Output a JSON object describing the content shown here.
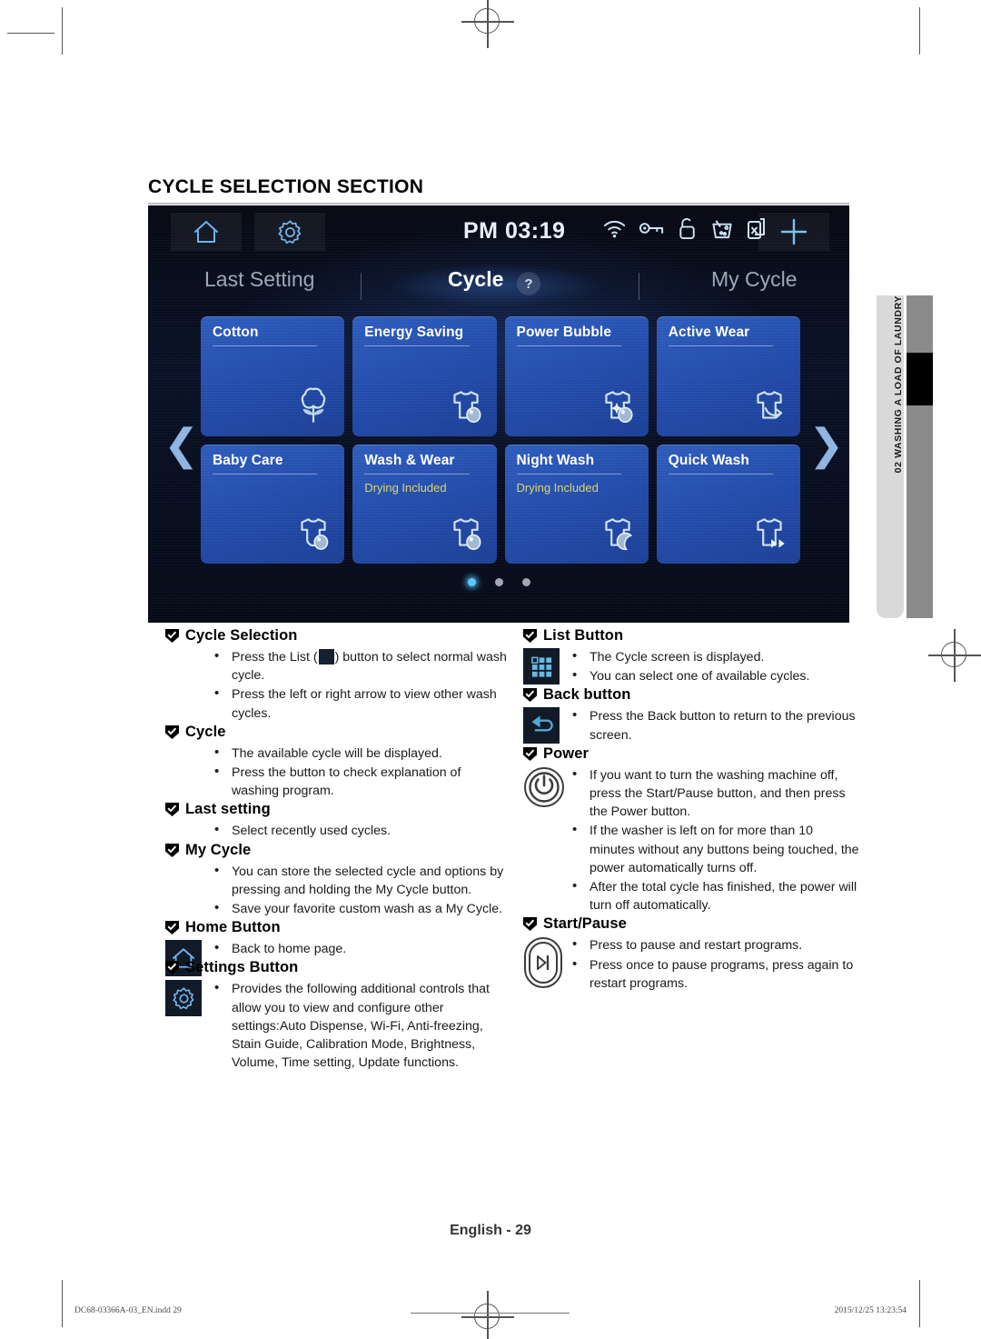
{
  "section": {
    "title": "CYCLE SELECTION SECTION"
  },
  "side_tab": {
    "label": "02 WASHING A LOAD OF LAUNDRY"
  },
  "display": {
    "status_bar": {
      "home_icon": "home-icon",
      "settings_icon": "gear-icon",
      "clock": "PM 03:19",
      "icons": [
        "wifi-icon",
        "key-icon",
        "door-unlock-icon",
        "auto-dispense-icon",
        "no-spin-icon"
      ],
      "add_icon": "plus-icon"
    },
    "tabs": [
      {
        "label": "Last Setting",
        "active": false
      },
      {
        "label": "Cycle",
        "active": true
      },
      {
        "label": "My Cycle",
        "active": false
      }
    ],
    "help_badge": "?",
    "arrow_left": "❮",
    "arrow_right": "❯",
    "cycles": [
      {
        "name": "Cotton",
        "sub": "",
        "icon": "cotton-boll-icon"
      },
      {
        "name": "Energy Saving",
        "sub": "",
        "icon": "shirt-bubble-icon"
      },
      {
        "name": "Power Bubble",
        "sub": "",
        "icon": "shirt-sparkle-bubble-icon"
      },
      {
        "name": "Active Wear",
        "sub": "",
        "icon": "shirt-arrow-icon"
      },
      {
        "name": "Baby Care",
        "sub": "",
        "icon": "onesie-bubble-icon"
      },
      {
        "name": "Wash & Wear",
        "sub": "Drying Included",
        "icon": "shirt-bubble-icon"
      },
      {
        "name": "Night Wash",
        "sub": "Drying Included",
        "icon": "shirt-moon-icon"
      },
      {
        "name": "Quick Wash",
        "sub": "",
        "icon": "shirt-fastforward-icon"
      }
    ],
    "page_dots": {
      "count": 3,
      "active_index": 0
    }
  },
  "left_column": [
    {
      "heading": "Cycle Selection",
      "icon": null,
      "bullets_html": [
        "Press the List (<span class=\"inline-list-ico\" data-name=\"list-grid-icon\" data-interactable=\"false\"></span>) button to select normal wash cycle.",
        "Press the left or right arrow to view other wash cycles."
      ]
    },
    {
      "heading": "Cycle",
      "icon": null,
      "bullets_html": [
        "The available cycle will be displayed.",
        "Press the button to check explanation of washing program."
      ]
    },
    {
      "heading": "Last setting",
      "icon": null,
      "bullets_html": [
        "Select recently used cycles."
      ]
    },
    {
      "heading": "My Cycle",
      "icon": null,
      "bullets_html": [
        "You can store the selected cycle and options by pressing and holding the My Cycle button.",
        "Save your favorite custom wash as a My Cycle."
      ]
    },
    {
      "heading": "Home Button",
      "icon": "home-icon",
      "bullets_html": [
        "Back to home page."
      ]
    },
    {
      "heading": "Settings Button",
      "icon": "gear-icon",
      "bullets_html": [
        "Provides the following additional controls that allow you to view and configure other settings:Auto Dispense, Wi-Fi, Anti-freezing, Stain Guide, Calibration Mode, Brightness, Volume, Time setting, Update functions."
      ]
    }
  ],
  "right_column": [
    {
      "heading": "List Button",
      "icon": "list-grid-icon",
      "bullets_html": [
        "The Cycle screen is displayed.",
        "You can select one of available cycles."
      ]
    },
    {
      "heading": "Back button",
      "icon": "back-arrow-icon",
      "bullets_html": [
        "Press the Back button to return to the previous screen."
      ]
    },
    {
      "heading": "Power",
      "icon": "power-icon",
      "bullets_html": [
        "If you want to turn the washing machine off,  press the Start/Pause button, and then press the Power button.",
        "If the washer is left on for more than 10 minutes without any buttons being touched, the power automatically turns off.",
        "After the total cycle has finished, the power will turn off automatically."
      ]
    },
    {
      "heading": "Start/Pause",
      "icon": "play-pause-icon",
      "bullets_html": [
        "Press to pause and restart programs.",
        "Press once to pause programs, press again to restart programs."
      ]
    }
  ],
  "footer": {
    "page_label": "English -  29",
    "file_name": "DC68-03366A-03_EN.indd  29",
    "timestamp": "2015/12/25  13:23:54"
  },
  "colors": {
    "tile_blue": "#2049a8",
    "accent_cyan": "#59c6ff",
    "sub_yellow": "#ddd46a",
    "display_bg": "#070b18"
  }
}
